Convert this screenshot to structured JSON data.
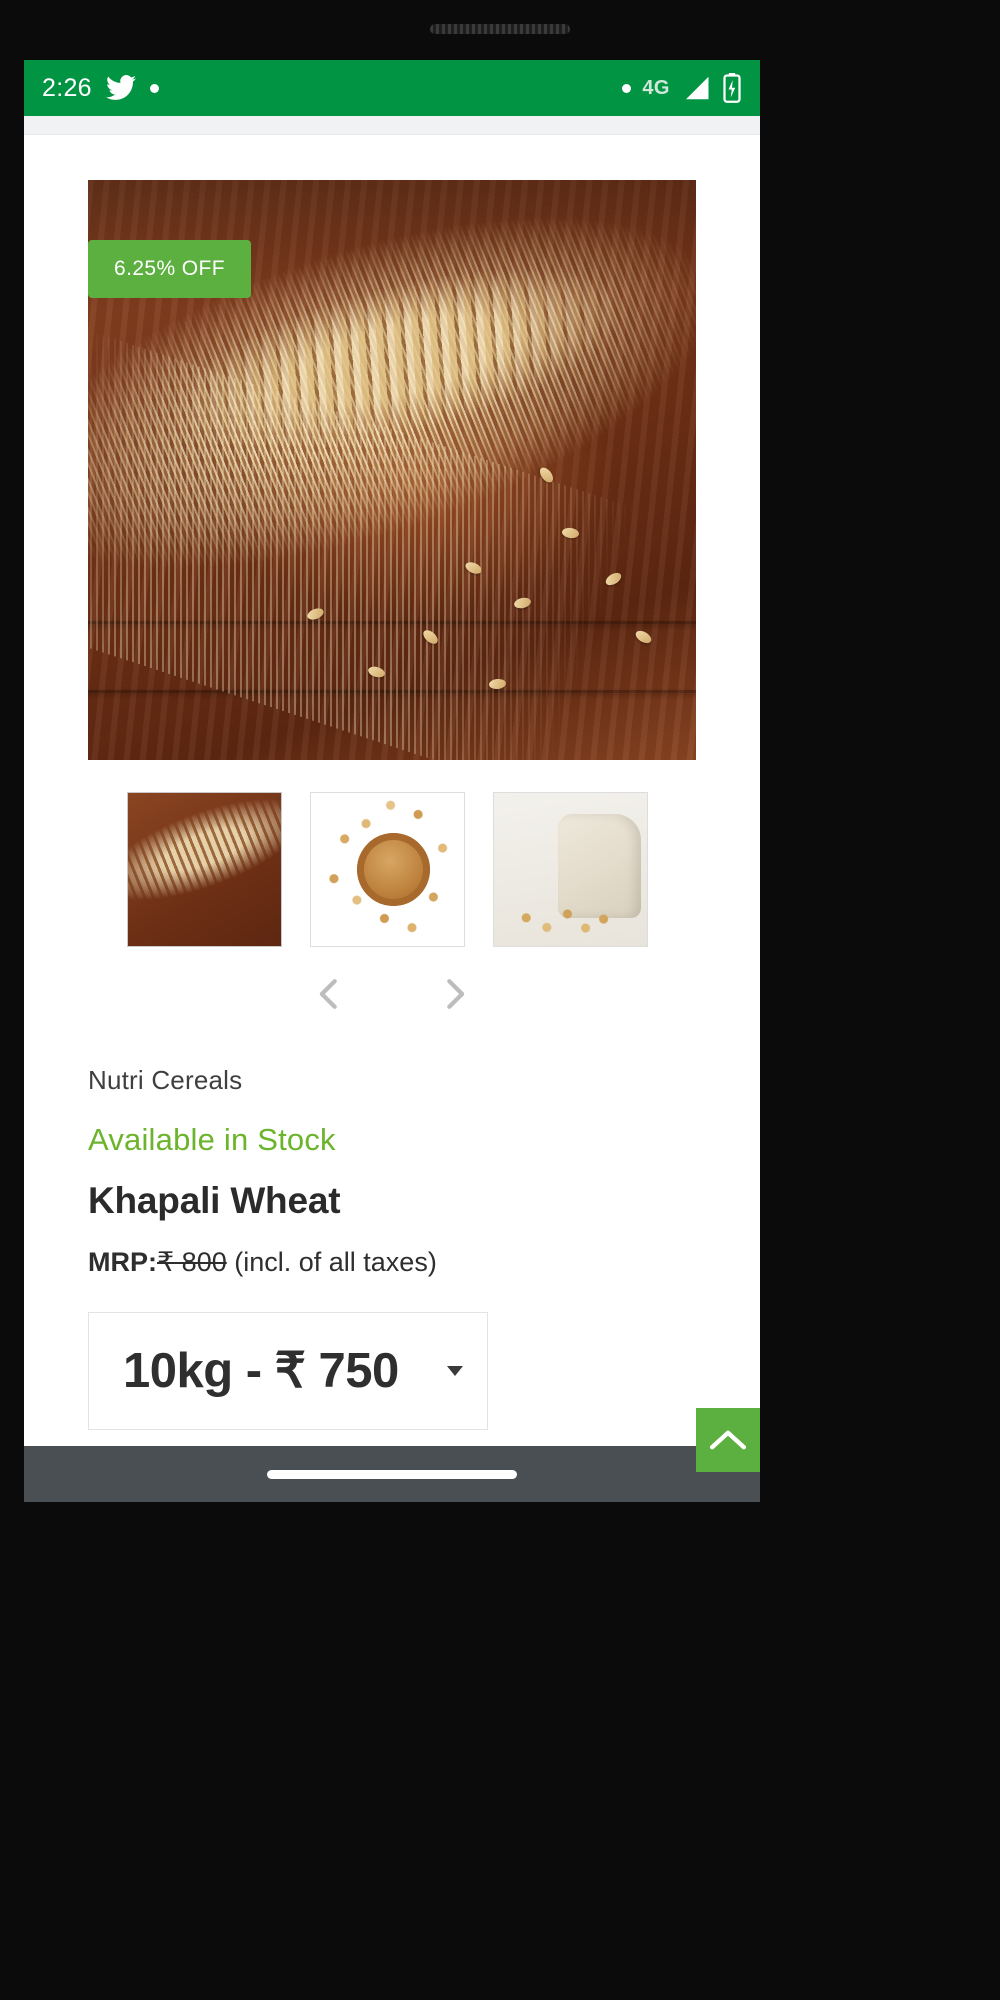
{
  "status_bar": {
    "time": "2:26",
    "twitter_icon": "twitter-bird-icon",
    "dot_icon": "notification-dot-icon",
    "right_dot_icon": "notification-dot-icon",
    "network_label": "4G",
    "signal_icon": "cellular-signal-icon",
    "battery_icon": "battery-charging-icon",
    "background_color": "#019543"
  },
  "product": {
    "discount_badge": "6.25% OFF",
    "badge_color": "#5cb040",
    "brand": "Nutri Cereals",
    "availability": "Available in Stock",
    "availability_color": "#6cb42c",
    "title": "Khapali Wheat",
    "mrp_label": "MRP:",
    "mrp_price": "₹ 800",
    "mrp_note": "(incl. of all taxes)",
    "selected_variant": "10kg - ₹ 750",
    "variant_options": [
      "10kg - ₹ 750"
    ]
  },
  "gallery": {
    "main_image_alt": "wheat-sheaves-on-wooden-table",
    "thumbnails": [
      {
        "alt": "wheat-sheaves-on-wooden-table",
        "active": true
      },
      {
        "alt": "wheat-grains-in-wooden-bowl",
        "active": false
      },
      {
        "alt": "wheat-grains-in-cloth-sack",
        "active": false
      }
    ],
    "prev_icon": "chevron-left-icon",
    "next_icon": "chevron-right-icon",
    "arrow_color": "#bdbdbd"
  },
  "scroll_top": {
    "icon": "chevron-up-icon",
    "color": "#5cb040"
  },
  "nav_bar": {
    "home_indicator": "home-indicator-pill",
    "background_color": "#4a4f54"
  }
}
